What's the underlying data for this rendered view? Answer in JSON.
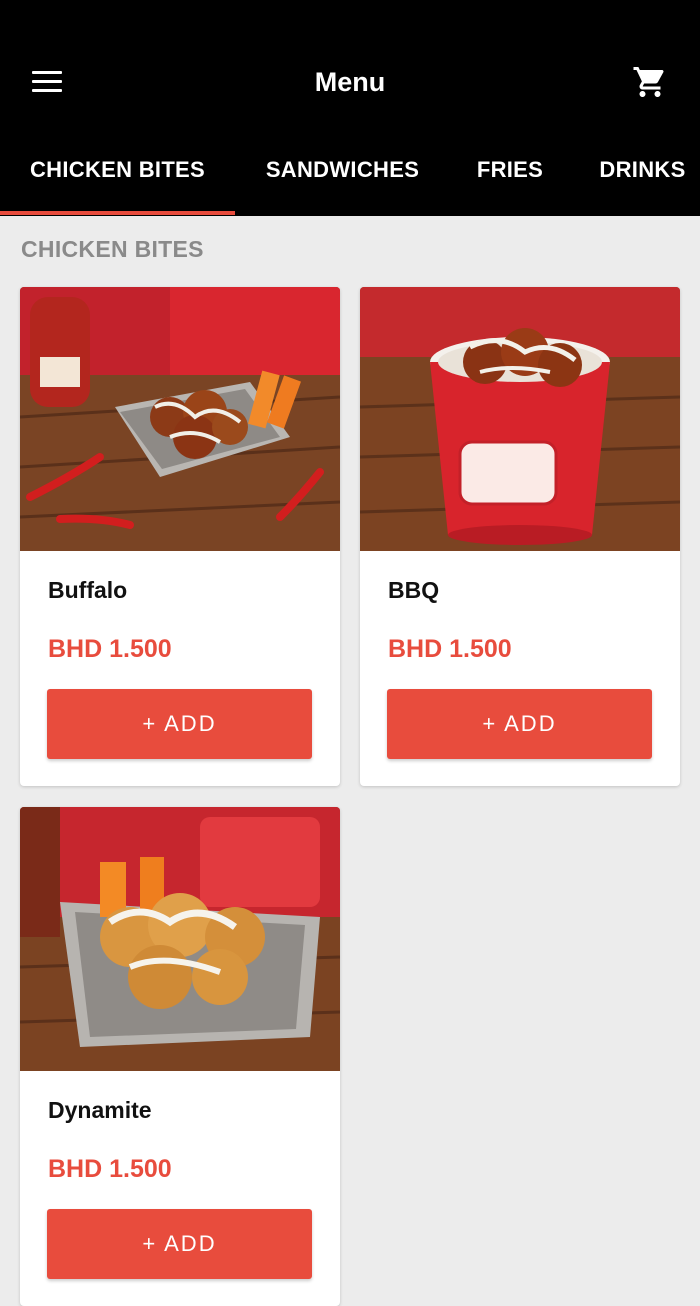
{
  "header": {
    "title": "Menu",
    "menu_icon": "hamburger-menu-icon",
    "cart_icon": "shopping-cart-icon"
  },
  "tabs": [
    {
      "label": "CHICKEN BITES",
      "active": true
    },
    {
      "label": "SANDWICHES",
      "active": false
    },
    {
      "label": "FRIES",
      "active": false
    },
    {
      "label": "DRINKS",
      "active": false
    }
  ],
  "section": {
    "title": "CHICKEN BITES"
  },
  "products": [
    {
      "name": "Buffalo",
      "price": "BHD 1.500",
      "add_label": "+ ADD"
    },
    {
      "name": "BBQ",
      "price": "BHD 1.500",
      "add_label": "+ ADD"
    },
    {
      "name": "Dynamite",
      "price": "BHD 1.500",
      "add_label": "+ ADD"
    }
  ],
  "colors": {
    "accent": "#e84c3d",
    "appbar": "#000000",
    "background": "#ececec"
  }
}
